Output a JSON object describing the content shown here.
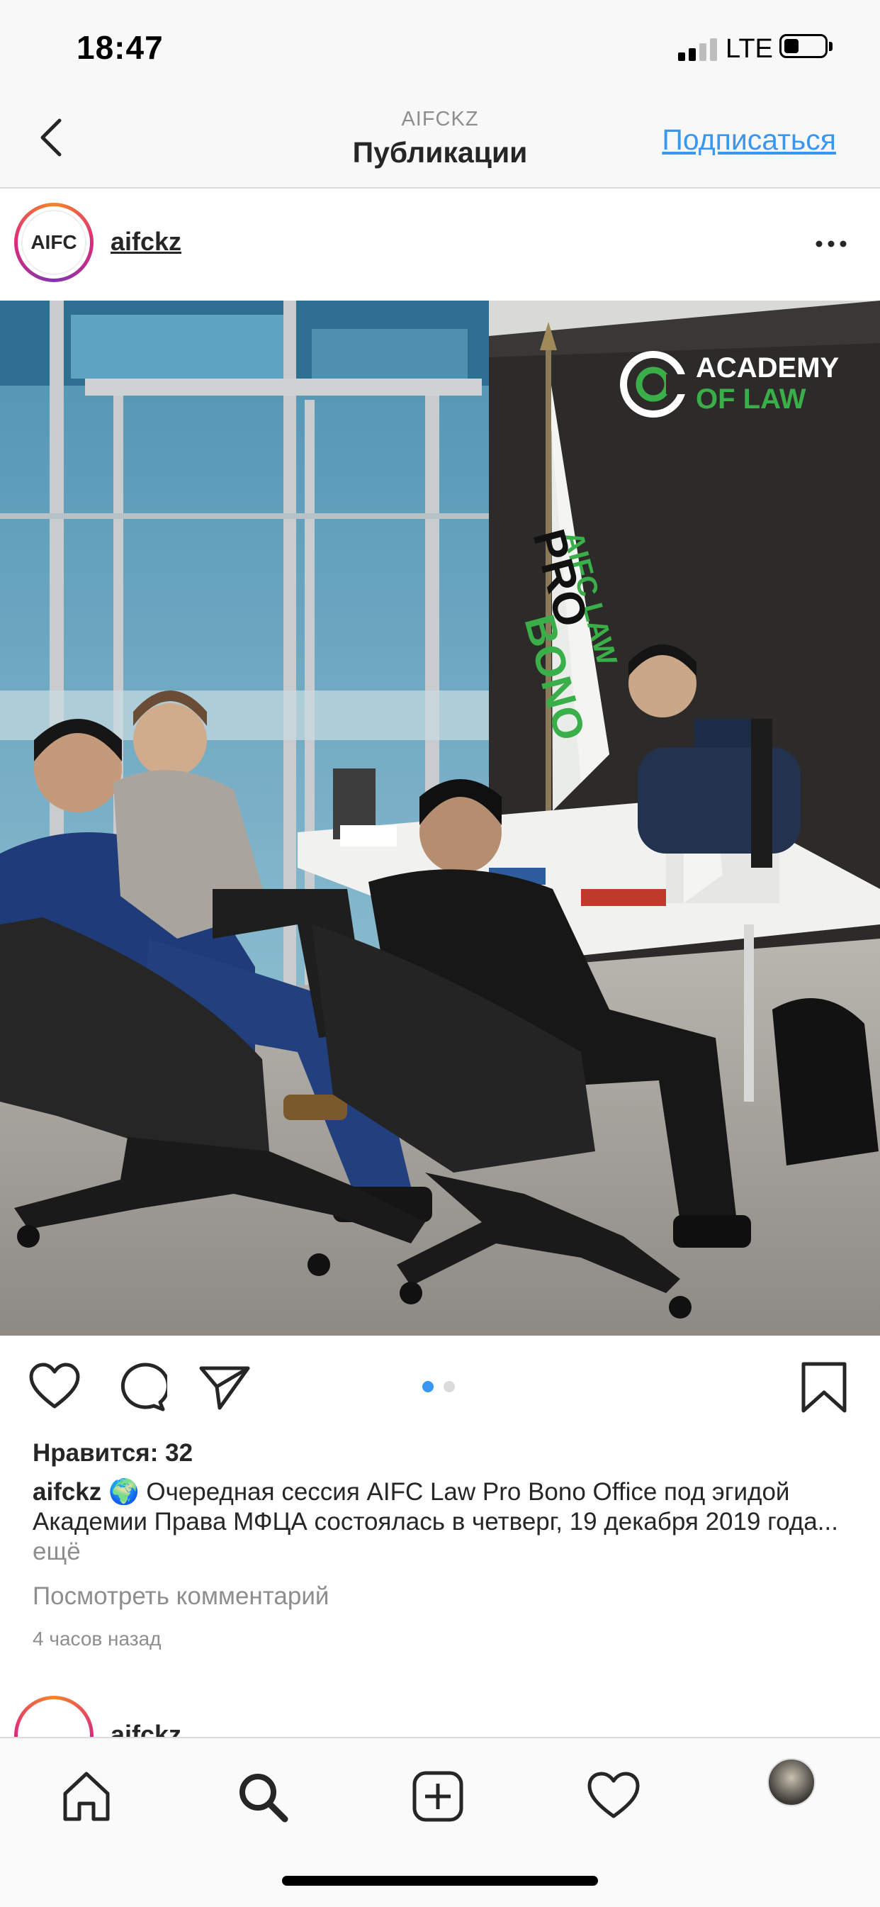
{
  "status_bar": {
    "time": "18:47",
    "network": "LTE",
    "battery_level": 0.3,
    "signal_bars": "2 of 4"
  },
  "header": {
    "account": "AIFCKZ",
    "title": "Публикации",
    "follow_label": "Подписаться",
    "back_icon": "chevron-left-icon"
  },
  "post": {
    "avatar_logo_text": "AIFC",
    "username": "aifckz",
    "more_icon": "more-horizontal-icon",
    "photo": {
      "logo_line1": "ACADEMY",
      "logo_line2": "OF LAW",
      "flag_text1": "AIFC LAW",
      "flag_text2": "PRO",
      "flag_text3": "BONO"
    },
    "carousel": {
      "current": 1,
      "total": 2
    },
    "likes": "Нравится: 32",
    "caption_user": "aifckz",
    "caption_emoji": "🌍",
    "caption_text": "Очередная сессия AIFC Law Pro Bono Office под эгидой Академии Права МФЦА состоялась в четверг, 19 декабря 2019 года...",
    "caption_more": "ещё",
    "view_comments": "Посмотреть комментарий",
    "time_ago": "4 часов назад"
  },
  "next_post": {
    "username": "aifckz"
  },
  "tab_bar": {
    "items": [
      "home-icon",
      "search-icon",
      "new-post-icon",
      "activity-heart-icon",
      "profile-avatar"
    ]
  },
  "colors": {
    "link_blue": "#3897f0",
    "text": "#262626",
    "muted": "#8e8e8e",
    "academy_green": "#3aae49"
  }
}
